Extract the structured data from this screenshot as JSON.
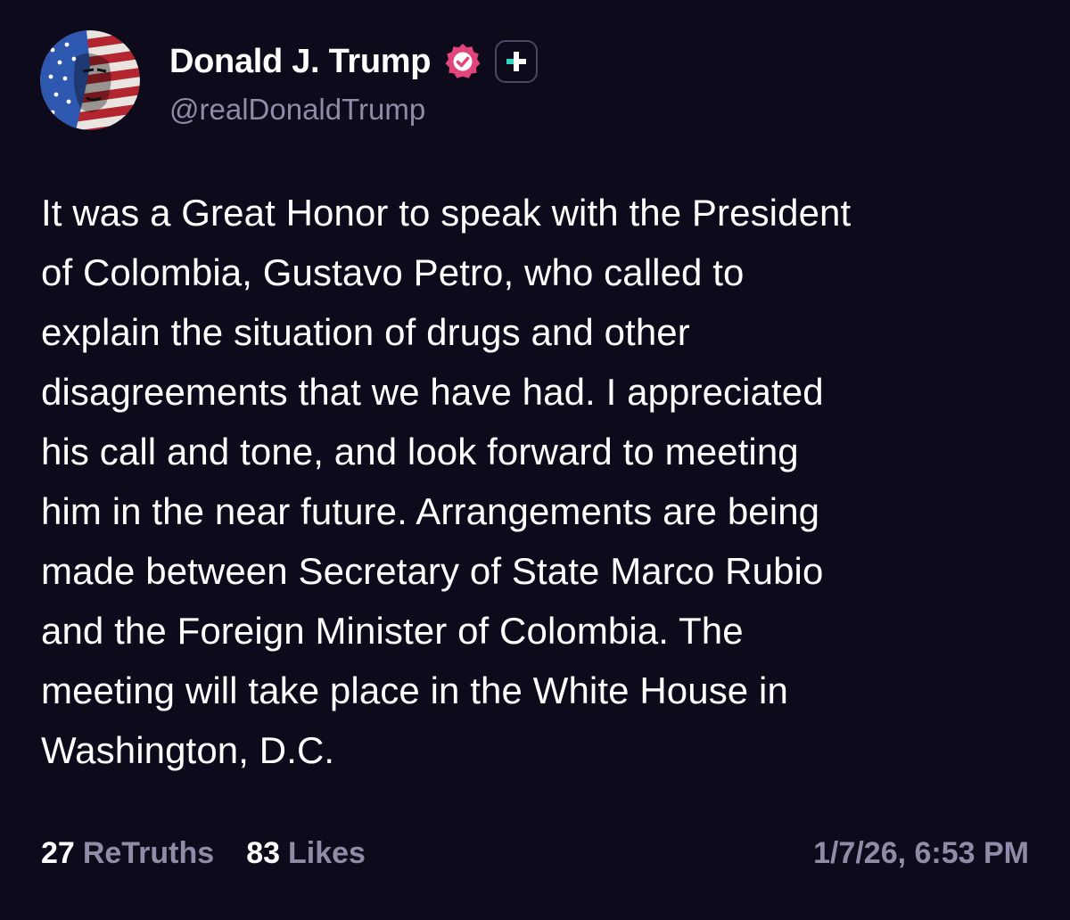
{
  "profile": {
    "display_name": "Donald J. Trump",
    "handle": "@realDonaldTrump",
    "avatar_icon": "flag-portrait-avatar",
    "verified_icon": "verified-badge-icon",
    "follow_icon": "plus-icon"
  },
  "post": {
    "lines": [
      "It was a Great Honor to speak with the President",
      "of Colombia, Gustavo Petro, who called to",
      "explain the situation of drugs and other",
      "disagreements that we have had. I appreciated",
      "his call and tone, and look forward to meeting",
      "him in the near future. Arrangements are being",
      "made between Secretary of State Marco Rubio",
      "and the Foreign Minister of Colombia. The",
      "meeting will take place in the White House in",
      "Washington, D.C."
    ]
  },
  "stats": {
    "retruths_count": "27",
    "retruths_label": "ReTruths",
    "likes_count": "83",
    "likes_label": "Likes"
  },
  "timestamp": "1/7/26, 6:53 PM",
  "colors": {
    "background": "#0c0a1b",
    "text": "#ffffff",
    "muted": "#8e8ca6",
    "verified": "#e2457a",
    "plus_accent": "#2fd8c2"
  }
}
